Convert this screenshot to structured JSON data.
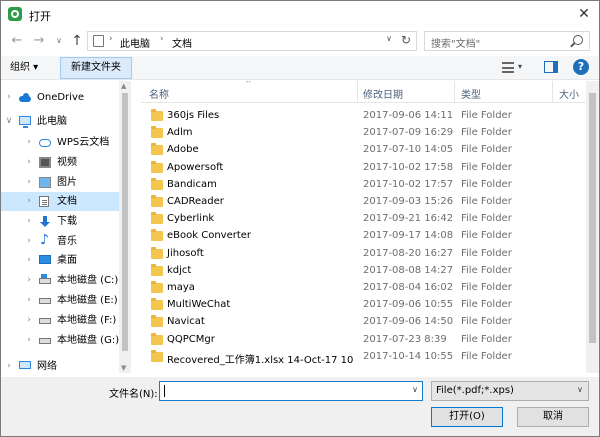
{
  "window": {
    "title": "打开",
    "close_glyph": "✕"
  },
  "nav": {
    "back_glyph": "←",
    "forward_glyph": "→",
    "recent_glyph": "∨",
    "up_glyph": "↑",
    "breadcrumb": [
      "此电脑",
      "文档"
    ],
    "breadcrumb_sep": "›",
    "dropdown_glyph": "∨",
    "refresh_glyph": "↻",
    "search_placeholder": "搜索\"文档\""
  },
  "toolbar": {
    "organize_label": "组织 ▾",
    "new_folder_label": "新建文件夹",
    "view_dropdown_glyph": "▾",
    "help_glyph": "?"
  },
  "sidebar": {
    "scroll_up_glyph": "▲",
    "scroll_down_glyph": "▼",
    "items": [
      {
        "label": "OneDrive",
        "icon": "onedrive-icon",
        "chevron": "›",
        "indent": 0
      },
      {
        "label": "此电脑",
        "icon": "computer-icon",
        "chevron": "∨",
        "indent": 0
      },
      {
        "label": "WPS云文档",
        "icon": "wps-cloud-icon",
        "chevron": "›",
        "indent": 1
      },
      {
        "label": "视频",
        "icon": "video-icon",
        "chevron": "›",
        "indent": 1
      },
      {
        "label": "图片",
        "icon": "pictures-icon",
        "chevron": "›",
        "indent": 1
      },
      {
        "label": "文档",
        "icon": "documents-icon",
        "chevron": "›",
        "indent": 1,
        "selected": true
      },
      {
        "label": "下载",
        "icon": "downloads-icon",
        "chevron": "›",
        "indent": 1
      },
      {
        "label": "音乐",
        "icon": "music-icon",
        "chevron": "›",
        "indent": 1
      },
      {
        "label": "桌面",
        "icon": "desktop-icon",
        "chevron": "›",
        "indent": 1
      },
      {
        "label": "本地磁盘 (C:)",
        "icon": "drive-c-icon",
        "chevron": "›",
        "indent": 1
      },
      {
        "label": "本地磁盘 (E:)",
        "icon": "drive-icon",
        "chevron": "›",
        "indent": 1
      },
      {
        "label": "本地磁盘 (F:)",
        "icon": "drive-icon",
        "chevron": "›",
        "indent": 1
      },
      {
        "label": "本地磁盘 (G:)",
        "icon": "drive-icon",
        "chevron": "›",
        "indent": 1
      },
      {
        "label": "网络",
        "icon": "network-icon",
        "chevron": "›",
        "indent": 0
      }
    ]
  },
  "file_list": {
    "sort_glyph": "^",
    "columns": {
      "name": "名称",
      "modified": "修改日期",
      "type": "类型",
      "size": "大小"
    },
    "rows": [
      {
        "name": "360js Files",
        "modified": "2017-09-06 14:11",
        "type": "File Folder"
      },
      {
        "name": "Adlm",
        "modified": "2017-07-09 16:29",
        "type": "File Folder"
      },
      {
        "name": "Adobe",
        "modified": "2017-07-10 14:05",
        "type": "File Folder"
      },
      {
        "name": "Apowersoft",
        "modified": "2017-10-02 17:58",
        "type": "File Folder"
      },
      {
        "name": "Bandicam",
        "modified": "2017-10-02 17:57",
        "type": "File Folder"
      },
      {
        "name": "CADReader",
        "modified": "2017-09-03 15:26",
        "type": "File Folder"
      },
      {
        "name": "Cyberlink",
        "modified": "2017-09-21 16:42",
        "type": "File Folder"
      },
      {
        "name": "eBook Converter",
        "modified": "2017-09-17 14:08",
        "type": "File Folder"
      },
      {
        "name": "Jihosoft",
        "modified": "2017-08-20 16:27",
        "type": "File Folder"
      },
      {
        "name": "kdjct",
        "modified": "2017-08-08 14:27",
        "type": "File Folder"
      },
      {
        "name": "maya",
        "modified": "2017-08-04 16:02",
        "type": "File Folder"
      },
      {
        "name": "MultiWeChat",
        "modified": "2017-09-06 10:55",
        "type": "File Folder"
      },
      {
        "name": "Navicat",
        "modified": "2017-09-06 14:50",
        "type": "File Folder"
      },
      {
        "name": "QQPCMgr",
        "modified": "2017-07-23 8:39",
        "type": "File Folder"
      },
      {
        "name": "Recovered_工作簿1.xlsx 14-Oct-17 10",
        "modified": "2017-10-14 10:55",
        "type": "File Folder"
      }
    ]
  },
  "bottom": {
    "filename_label": "文件名(N):",
    "filename_value": "",
    "filename_dropdown_glyph": "∨",
    "filetype_value": "File(*.pdf;*.xps)",
    "filetype_dropdown_glyph": "∨",
    "open_label": "打开(O)",
    "cancel_label": "取消"
  }
}
